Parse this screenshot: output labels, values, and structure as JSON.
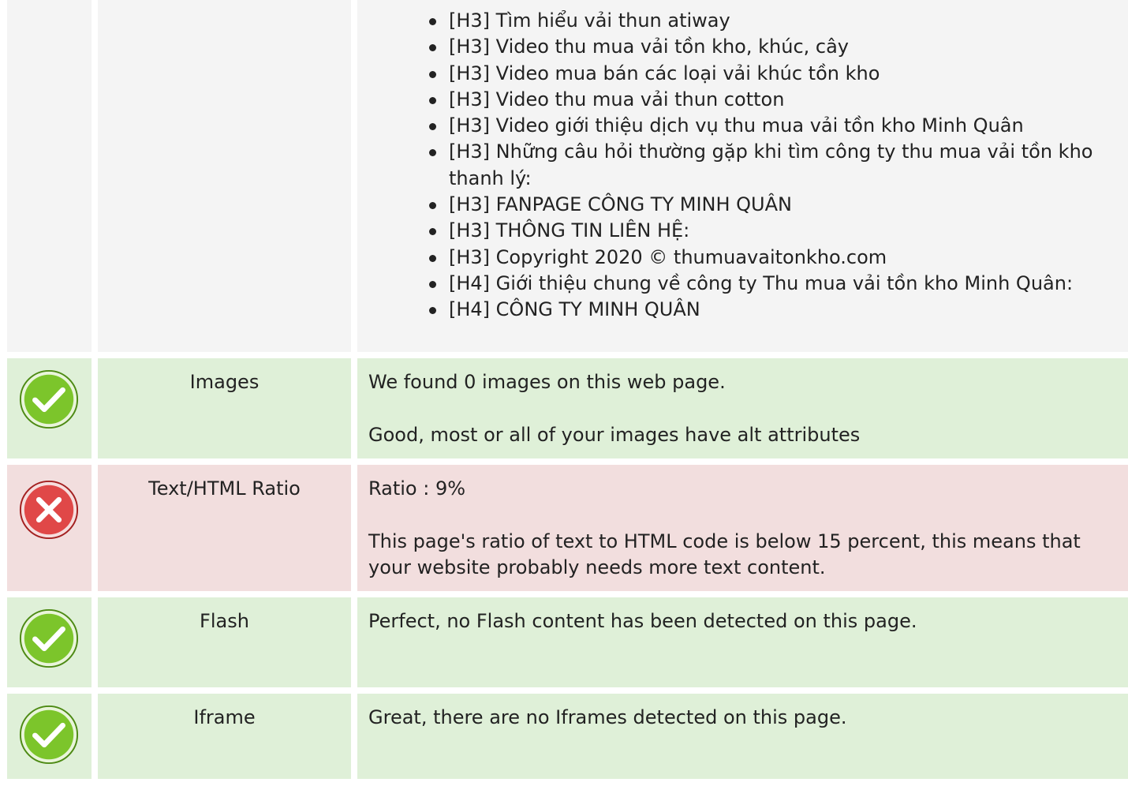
{
  "headings_section": {
    "items": [
      "[H3] Tìm hiểu vải thun atiway",
      "[H3] Video thu mua vải tồn kho, khúc, cây",
      "[H3] Video mua bán các loại vải khúc tồn kho",
      "[H3] Video thu mua vải thun cotton",
      "[H3] Video giới thiệu dịch vụ thu mua vải tồn kho Minh Quân",
      "[H3] Những câu hỏi thường gặp khi tìm công ty thu mua vải tồn kho thanh lý:",
      "[H3] FANPAGE CÔNG TY MINH QUÂN",
      "[H3] THÔNG TIN LIÊN HỆ:",
      "[H3] Copyright 2020 © thumuavaitonkho.com",
      "[H4] Giới thiệu chung về công ty Thu mua vải tồn kho Minh Quân:",
      "[H4] CÔNG TY MINH QUÂN"
    ]
  },
  "checks": {
    "images": {
      "status": "pass",
      "icon": "check-circle-icon",
      "name": "Images",
      "line1": "We found 0 images on this web page.",
      "line2": "Good, most or all of your images have alt attributes"
    },
    "ratio": {
      "status": "fail",
      "icon": "error-circle-icon",
      "name": "Text/HTML Ratio",
      "line1": "Ratio : 9%",
      "line2": "This page's ratio of text to HTML code is below 15 percent, this means that your website probably needs more text content."
    },
    "flash": {
      "status": "pass",
      "icon": "check-circle-icon",
      "name": "Flash",
      "line1": "Perfect, no Flash content has been detected on this page."
    },
    "iframe": {
      "status": "pass",
      "icon": "check-circle-icon",
      "name": "Iframe",
      "line1": "Great, there are no Iframes detected on this page."
    }
  },
  "colors": {
    "pass_bg": "#dff0d8",
    "fail_bg": "#f2dede",
    "neutral_bg": "#f4f4f4",
    "pass_icon": "#7cc52b",
    "fail_icon": "#e04848"
  }
}
